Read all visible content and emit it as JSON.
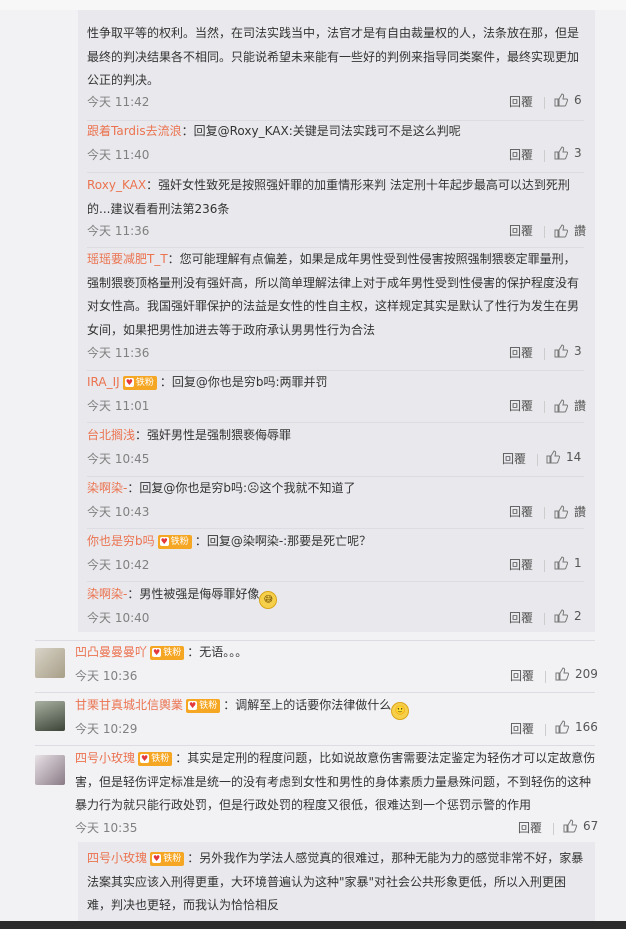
{
  "top_partial": {
    "line1": "性争取平等的权利。当然，在司法实践当中，法官才是有自由裁量权的人，法条放在那，但是",
    "line2": "最终的判决结果各不相同。只能说希望未来能有一些好的判例来指导同类案件，最终实现更加",
    "line3": "公正的判决。",
    "time": "今天 11:42",
    "reply": "回覆",
    "likes": "6"
  },
  "nested": [
    {
      "name": "跟着Tardis去流浪",
      "badge": "",
      "text": "：回复@Roxy_KAX:关键是司法实践可不是这么判呢",
      "text2": "",
      "time": "今天 11:40",
      "reply": "回覆",
      "likes": "3"
    },
    {
      "name": "Roxy_KAX",
      "badge": "",
      "text": "：强奸女性致死是按照强奸罪的加重情形来判 法定刑十年起步最高可以达到死刑",
      "text2": "的...建议看看刑法第236条",
      "time": "今天 11:36",
      "reply": "回覆",
      "likes": "讚"
    },
    {
      "name": "瑶瑶要减肥T_T",
      "badge": "",
      "text": "：您可能理解有点偏差，如果是成年男性受到性侵害按照强制猥亵定罪量刑，",
      "text2": "强制猥亵顶格量刑没有强奸高，所以简单理解法律上对于成年男性受到性侵害的保护程度没有",
      "text3": "对女性高。我国强奸罪保护的法益是女性的性自主权，这样规定其实是默认了性行为发生在男",
      "text4": "女间，如果把男性加进去等于政府承认男男性行为合法",
      "time": "今天 11:36",
      "reply": "回覆",
      "likes": "3"
    },
    {
      "name": "IRA_IJ",
      "badge": "铁粉",
      "text": "：回复@你也是穷b吗:两罪并罚",
      "time": "今天 11:01",
      "reply": "回覆",
      "likes": "讚"
    },
    {
      "name": "台北搁浅",
      "badge": "",
      "text": "：强奸男性是强制猥亵侮辱罪",
      "time": "今天 10:45",
      "reply": "回覆",
      "likes": "14"
    },
    {
      "name": "染啊染-",
      "badge": "",
      "text": "：回复@你也是穷b吗:☹这个我就不知道了",
      "time": "今天 10:43",
      "reply": "回覆",
      "likes": "讚"
    },
    {
      "name": "你也是穷b吗",
      "badge": "铁粉",
      "text": "：回复@染啊染-:那要是死亡呢？",
      "time": "今天 10:42",
      "reply": "回覆",
      "likes": "1"
    },
    {
      "name": "染啊染-",
      "badge": "",
      "text": "：男性被强是侮辱罪好像",
      "emoji": "😅",
      "time": "今天 10:40",
      "reply": "回覆",
      "likes": "2"
    }
  ],
  "main": [
    {
      "name": "凹凸曼曼曼吖",
      "badge": "铁粉",
      "text": "：无语。。。",
      "time": "今天 10:36",
      "reply": "回覆",
      "likes": "209"
    },
    {
      "name": "甘栗甘真城北信輿業",
      "badge": "铁粉",
      "text": "：调解至上的话要你法律做什么",
      "emoji": "🙂",
      "time": "今天 10:29",
      "reply": "回覆",
      "likes": "166"
    },
    {
      "name": "四号小玫瑰",
      "badge": "铁粉",
      "text": "：其实是定刑的程度问题，比如说故意伤害需要法定鉴定为轻伤才可以定故意伤",
      "text2": "害，但是轻伤评定标准是统一的没有考虑到女性和男性的身体素质力量悬殊问题，不到轻伤的这种",
      "text3": "暴力行为就只能行政处罚，但是行政处罚的程度又很低，很难达到一个惩罚示警的作用",
      "time": "今天 10:35",
      "reply": "回覆",
      "likes": "67"
    }
  ],
  "bottom_nested": {
    "name": "四号小玫瑰",
    "badge": "铁粉",
    "text": "：另外我作为学法人感觉真的很难过，那种无能为力的感觉非常不好，家暴",
    "text2": "法案其实应该入刑得更重，大环境普遍认为这种\"家暴\"对社会公共形象更低，所以入刑更困",
    "text3": "难，判决也更轻，而我认为恰恰相反"
  }
}
